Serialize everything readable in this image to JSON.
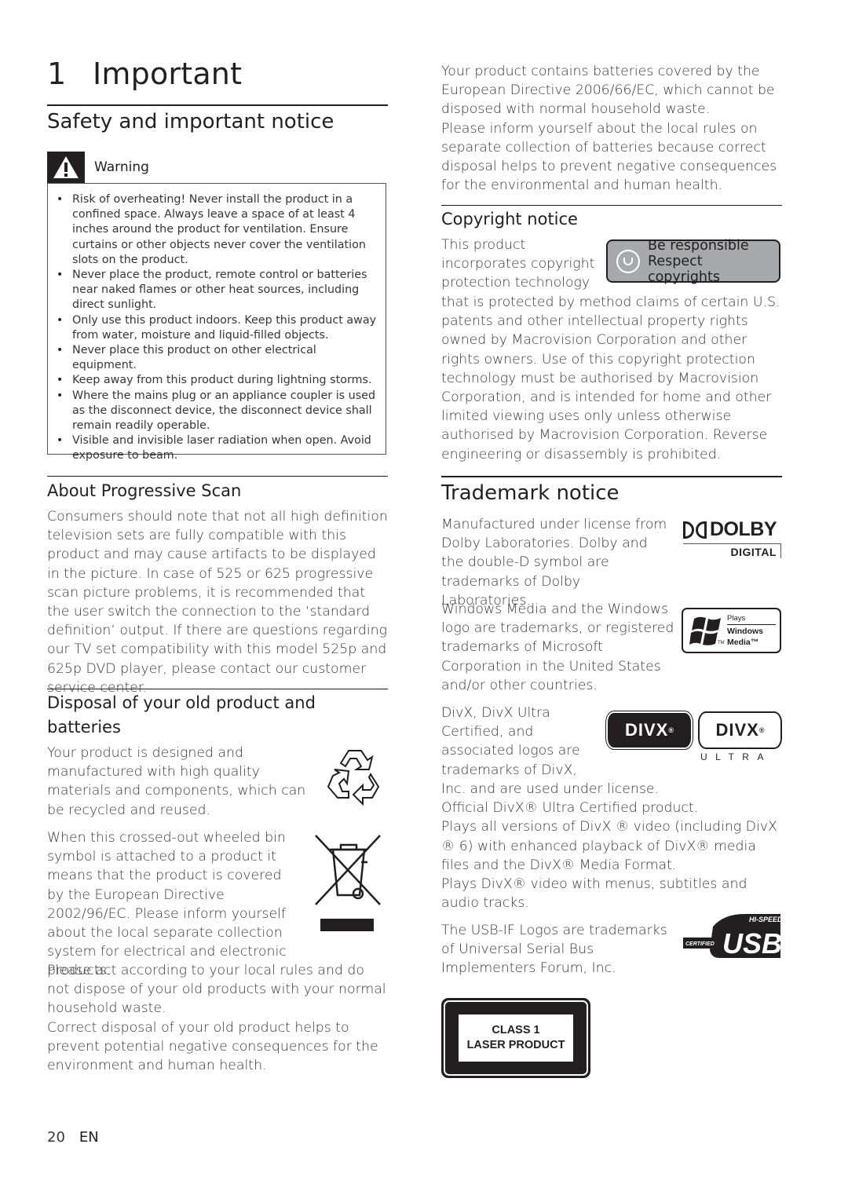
{
  "chapter": {
    "number": "1",
    "title": "Important"
  },
  "safety": {
    "heading": "Safety and important notice",
    "warning_label": "Warning",
    "warning_items": [
      "Risk of overheating! Never install the product in a confined space. Always leave a space of at least 4 inches around the product for ventilation. Ensure curtains or other objects never cover the ventilation slots on the product.",
      "Never place the product, remote control or batteries near naked flames or other heat sources, including direct sunlight.",
      "Only use this product indoors. Keep this product away from water, moisture and liquid-filled objects.",
      "Never place this product on other electrical equipment.",
      "Keep away from this product during lightning storms.",
      "Where the mains plug or an appliance coupler is used as the disconnect device, the disconnect device shall remain readily operable.",
      "Visible and invisible laser radiation when open. Avoid exposure to beam."
    ]
  },
  "progressive": {
    "heading": "About Progressive Scan",
    "body": "Consumers should note that not all high definition television sets are fully compatible with this product and may cause artifacts to be displayed in the picture. In case of 525 or 625 progressive scan picture problems, it is recommended that the user switch the connection to the ‘standard definition’ output. If there are questions regarding our TV set compatibility with this model 525p and 625p DVD player, please contact our customer service center."
  },
  "disposal": {
    "heading": "Disposal of your old product and batteries",
    "recycle_text": "Your product is designed and manufactured with high quality materials and components, which can be recycled and reused.",
    "weee_text": "When this crossed-out wheeled bin symbol is attached to a product it means that the product is covered by the European Directive 2002/96/EC. Please inform yourself about the local separate collection system for electrical and electronic products.",
    "act_text": "Please act according to your local rules and do not dispose of your old products with your normal household waste.",
    "correct_text": "Correct disposal of your old product helps to prevent potential negative consequences for the environment and human health.",
    "batteries_text_1": "Your product contains batteries covered by the European Directive 2006/66/EC, which cannot be disposed with normal household waste.",
    "batteries_text_2": "Please inform yourself about the local rules on separate collection of batteries because correct disposal helps to prevent negative consequences for the environmental and human health."
  },
  "copyright": {
    "heading": "Copyright notice",
    "intro_lines": [
      "This product",
      "incorporates copyright",
      "protection technology"
    ],
    "body": "that is protected by method claims of certain U.S. patents and other intellectual property rights owned by Macrovision Corporation and other rights owners. Use of this copyright protection technology must be authorised by Macrovision Corporation, and is intended for home and other limited viewing uses only unless otherwise authorised by Macrovision Corporation. Reverse engineering or disassembly is prohibited.",
    "badge_line1": "Be responsible",
    "badge_line2": "Respect copyrights"
  },
  "trademark": {
    "heading": "Trademark notice",
    "dolby_text": "Manufactured under license from Dolby Laboratories. Dolby and the double-D symbol are trademarks of Dolby Laboratories.",
    "dolby_logo_word": "DOLBY",
    "dolby_logo_sub": "DIGITAL",
    "windows_text": "Windows Media and the Windows logo are trademarks, or registered trademarks of Microsoft Corporation in the United States and/or other countries.",
    "windows_logo_plays": "Plays",
    "windows_logo_name1": "Windows",
    "windows_logo_name2": "Media™",
    "windows_logo_tm": "TM",
    "divx_intro_lines": [
      "DivX, DivX Ultra",
      "Certified, and",
      "associated logos are",
      "trademarks of DivX,"
    ],
    "divx_line_after": "Inc. and are used under license.",
    "divx_official": "Official DivX® Ultra Certified product.",
    "divx_plays_all": "Plays all versions of DivX ® video (including DivX ® 6) with enhanced playback of DivX® media files and the DivX® Media Format.",
    "divx_plays_menus": "Plays DivX® video with menus, subtitles and audio tracks.",
    "divx_logo_word": "DIVX",
    "divx_logo_ultra": "ULTRA",
    "usb_text": "The USB-IF Logos are trademarks of Universal Serial Bus Implementers Forum, Inc.",
    "usb_logo_top": "HI-SPEED",
    "usb_logo_left": "CERTIFIED",
    "usb_logo_word": "USB"
  },
  "laser_label": {
    "line1": "CLASS 1",
    "line2": "LASER PRODUCT"
  },
  "footer": {
    "page_number": "20",
    "language": "EN"
  }
}
